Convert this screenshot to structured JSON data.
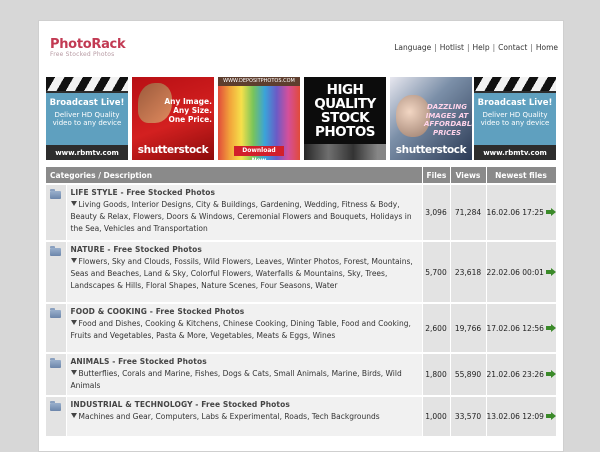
{
  "site": {
    "title": "PhotoRack",
    "subtitle": "Free Stocked Photos"
  },
  "topnav": [
    {
      "label": "Language"
    },
    {
      "label": "Hotlist"
    },
    {
      "label": "Help"
    },
    {
      "label": "Contact"
    },
    {
      "label": "Home"
    }
  ],
  "banners": {
    "rbm1": {
      "line1": "Broadcast Live!",
      "line2": "Deliver HD Quality video to any device",
      "url": "www.rbmtv.com"
    },
    "ss1": {
      "text": "Any Image. Any Size. One Price.",
      "brand": "shutterstock"
    },
    "dp": {
      "header": "WWW.DEPOSITPHOTOS.COM",
      "button": "Download Now"
    },
    "hq": {
      "text": "HIGH QUALITY STOCK PHOTOS"
    },
    "ss2": {
      "text": "DAZZLING IMAGES AT AFFORDABLE PRICES",
      "brand": "shutterstock"
    },
    "rbm2": {
      "line1": "Broadcast Live!",
      "line2": "Deliver HD Quality video to any device",
      "url": "www.rbmtv.com"
    }
  },
  "table": {
    "headers": {
      "category": "Categories / Description",
      "files": "Files",
      "views": "Views",
      "newest": "Newest files"
    },
    "rows": [
      {
        "title": "LIFE STYLE - Free Stocked Photos",
        "subs": "Living Goods, Interior Designs, City & Buildings, Gardening, Wedding, Fitness & Body, Beauty & Relax, Flowers, Doors & Windows, Ceremonial Flowers and Bouquets, Holidays in the Sea, Vehicles and Transportation",
        "files": "3,096",
        "views": "71,284",
        "newest": "16.02.06 17:25"
      },
      {
        "title": "NATURE - Free Stocked Photos",
        "subs": "Flowers, Sky and Clouds, Fossils, Wild Flowers, Leaves, Winter Photos, Forest, Mountains, Seas and Beaches, Land & Sky, Colorful Flowers, Waterfalls & Mountains, Sky, Trees, Landscapes & Hills, Floral Shapes, Nature Scenes, Four Seasons, Water",
        "files": "5,700",
        "views": "23,618",
        "newest": "22.02.06 00:01"
      },
      {
        "title": "FOOD & COOKING - Free Stocked Photos",
        "subs": "Food and Dishes, Cooking & Kitchens, Chinese Cooking, Dining Table, Food and Cooking, Fruits and Vegetables, Pasta & More, Vegetables, Meats & Eggs, Wines",
        "files": "2,600",
        "views": "19,766",
        "newest": "17.02.06 12:56"
      },
      {
        "title": "ANIMALS - Free Stocked Photos",
        "subs": "Butterflies, Corals and Marine, Fishes, Dogs & Cats, Small Animals, Marine, Birds, Wild Animals",
        "files": "1,800",
        "views": "55,890",
        "newest": "21.02.06 23:26"
      },
      {
        "title": "INDUSTRIAL & TECHNOLOGY - Free Stocked Photos",
        "subs": "Machines and Gear, Computers, Labs & Experimental, Roads, Tech Backgrounds",
        "files": "1,000",
        "views": "33,570",
        "newest": "13.02.06 12:09"
      }
    ]
  }
}
